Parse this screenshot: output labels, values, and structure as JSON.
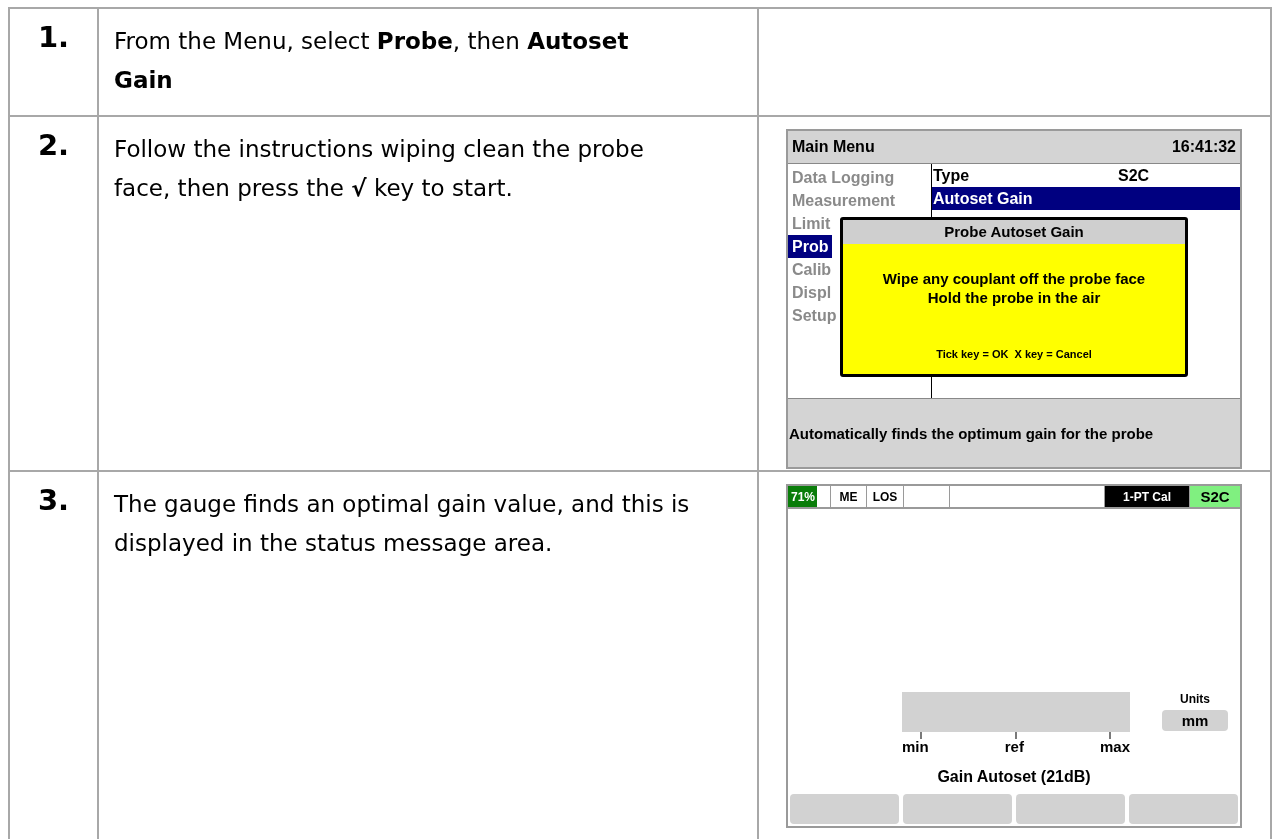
{
  "steps": [
    {
      "number": "1.",
      "text": "From the Menu, select **Probe**, then **Autoset Gain**"
    },
    {
      "number": "2.",
      "text": "Follow the instructions wiping clean the probe face, then press the **√** key to start.",
      "screen": {
        "kind": "menu",
        "title": "Main Menu",
        "time": "16:41:32",
        "menu_items": [
          {
            "label": "Data Logging",
            "selected": false
          },
          {
            "label": "Measurement",
            "selected": false
          },
          {
            "label": "Limit",
            "selected": false
          },
          {
            "label": "Prob",
            "selected": true
          },
          {
            "label": "Calib",
            "selected": false
          },
          {
            "label": "Displ",
            "selected": false
          },
          {
            "label": "Setup",
            "selected": false
          }
        ],
        "settings": [
          {
            "label": "Type",
            "value": "S2C",
            "selected": false
          },
          {
            "label": "Autoset Gain",
            "selected": true
          }
        ],
        "dialog": {
          "title": "Probe Autoset Gain",
          "lines": [
            "Wipe any couplant off the probe face",
            "Hold the probe in the air"
          ],
          "hint": "Tick key = OK  X key = Cancel"
        },
        "help": "Automatically finds the optimum gain for the probe"
      }
    },
    {
      "number": "3.",
      "text": "The gauge finds an optimal gain value, and this is displayed in the status message area.",
      "screen": {
        "kind": "gauge",
        "status_cells": [
          {
            "kind": "battery",
            "text": "71%"
          },
          {
            "kind": "plain",
            "text": "ME"
          },
          {
            "kind": "plain",
            "text": "LOS"
          },
          {
            "kind": "blank"
          },
          {
            "kind": "blank"
          },
          {
            "kind": "dark",
            "text": "1-PT Cal"
          },
          {
            "kind": "probe",
            "text": "S2C"
          }
        ],
        "scale_labels": [
          "min",
          "ref",
          "max"
        ],
        "units_label": "Units",
        "units_value": "mm",
        "message": "Gain Autoset (21dB)"
      }
    }
  ]
}
